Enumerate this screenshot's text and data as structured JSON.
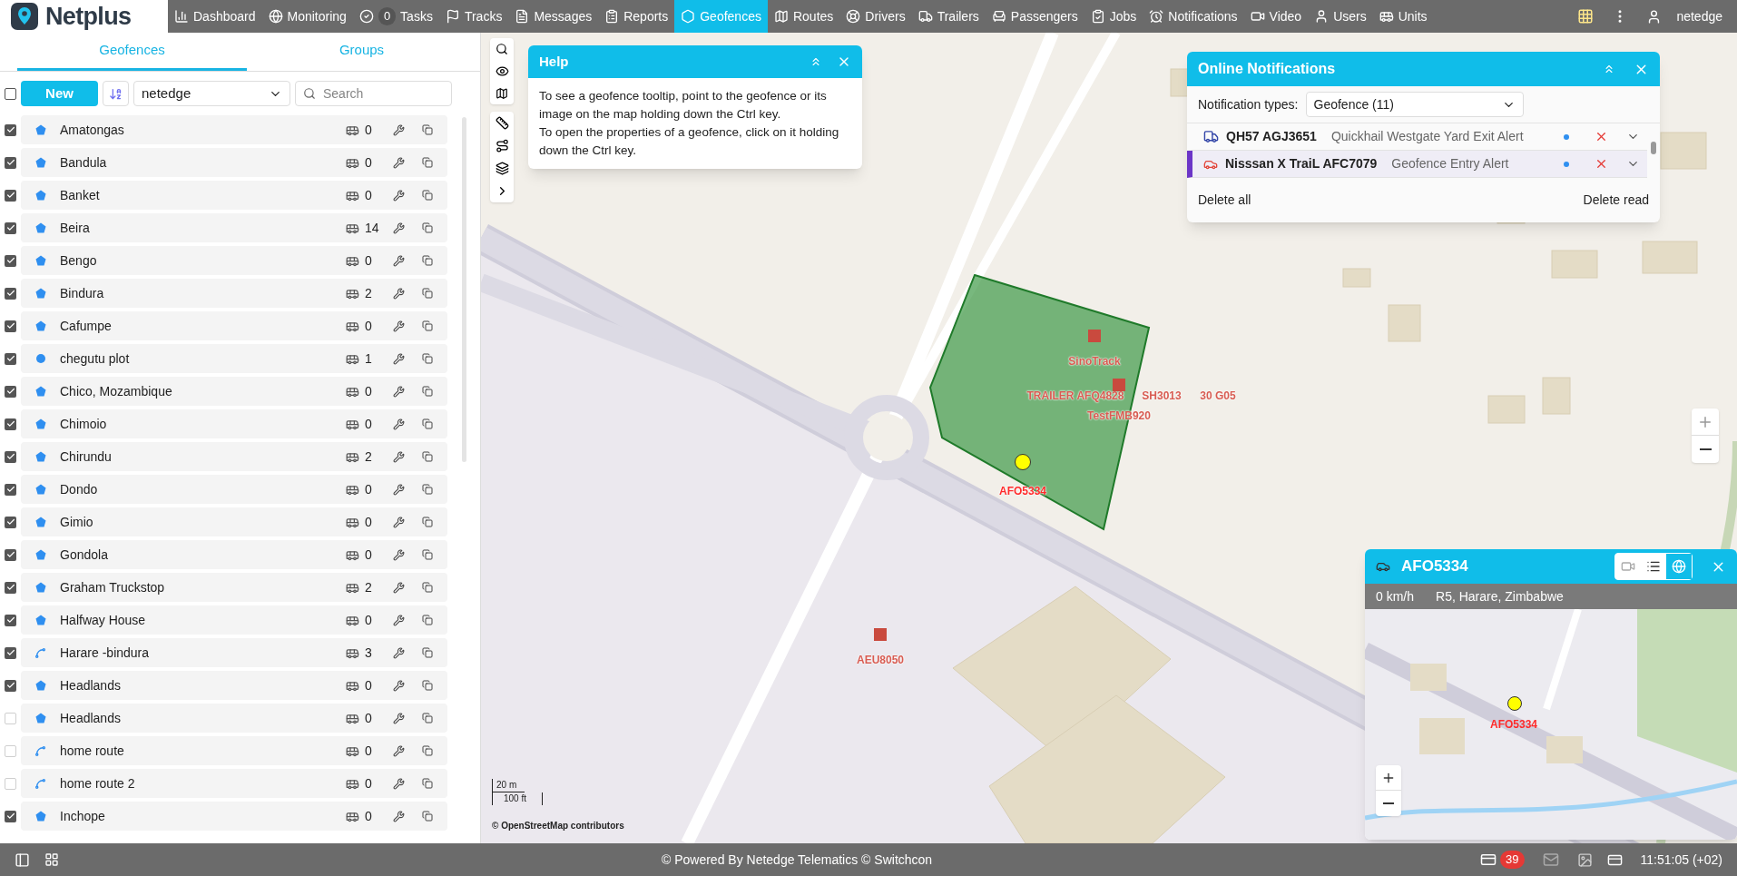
{
  "brand": "Netplus",
  "nav": [
    {
      "label": "Dashboard",
      "selected": false
    },
    {
      "label": "Monitoring",
      "selected": false
    },
    {
      "label": "Tasks",
      "badge": "0",
      "selected": false
    },
    {
      "label": "Tracks",
      "selected": false
    },
    {
      "label": "Messages",
      "selected": false
    },
    {
      "label": "Reports",
      "selected": false
    },
    {
      "label": "Geofences",
      "selected": true
    },
    {
      "label": "Routes",
      "selected": false
    },
    {
      "label": "Drivers",
      "selected": false
    },
    {
      "label": "Trailers",
      "selected": false
    },
    {
      "label": "Passengers",
      "selected": false
    },
    {
      "label": "Jobs",
      "selected": false
    },
    {
      "label": "Notifications",
      "selected": false
    },
    {
      "label": "Video",
      "selected": false
    },
    {
      "label": "Users",
      "selected": false
    },
    {
      "label": "Units",
      "selected": false
    }
  ],
  "user": "netedge",
  "panel_tabs": [
    {
      "label": "Geofences",
      "selected": true
    },
    {
      "label": "Groups",
      "selected": false
    }
  ],
  "toolbar": {
    "select_all": false,
    "new_button": "New",
    "account": "netedge",
    "search": {
      "placeholder": "Search"
    }
  },
  "geofences": [
    {
      "name": "Amatongas",
      "kind": "polygon",
      "checked": true,
      "units": "0"
    },
    {
      "name": "Bandula",
      "kind": "polygon",
      "checked": true,
      "units": "0"
    },
    {
      "name": "Banket",
      "kind": "polygon",
      "checked": true,
      "units": "0"
    },
    {
      "name": "Beira",
      "kind": "polygon",
      "checked": true,
      "units": "14"
    },
    {
      "name": "Bengo",
      "kind": "polygon",
      "checked": true,
      "units": "0"
    },
    {
      "name": "Bindura",
      "kind": "polygon",
      "checked": true,
      "units": "2"
    },
    {
      "name": "Cafumpe",
      "kind": "polygon",
      "checked": true,
      "units": "0"
    },
    {
      "name": "chegutu plot",
      "kind": "circle",
      "checked": true,
      "units": "1"
    },
    {
      "name": "Chico, Mozambique",
      "kind": "polygon",
      "checked": true,
      "units": "0"
    },
    {
      "name": "Chimoio",
      "kind": "polygon",
      "checked": true,
      "units": "0"
    },
    {
      "name": "Chirundu",
      "kind": "polygon",
      "checked": true,
      "units": "2"
    },
    {
      "name": "Dondo",
      "kind": "polygon",
      "checked": true,
      "units": "0"
    },
    {
      "name": "Gimio",
      "kind": "polygon",
      "checked": true,
      "units": "0"
    },
    {
      "name": "Gondola",
      "kind": "polygon",
      "checked": true,
      "units": "0"
    },
    {
      "name": "Graham Truckstop",
      "kind": "polygon",
      "checked": true,
      "units": "2"
    },
    {
      "name": "Halfway House",
      "kind": "polygon",
      "checked": true,
      "units": "0"
    },
    {
      "name": "Harare -bindura",
      "kind": "line",
      "checked": true,
      "units": "3"
    },
    {
      "name": "Headlands",
      "kind": "polygon",
      "checked": true,
      "units": "0"
    },
    {
      "name": "Headlands",
      "kind": "polygon",
      "checked": false,
      "units": "0"
    },
    {
      "name": "home route",
      "kind": "line",
      "checked": false,
      "units": "0"
    },
    {
      "name": "home route 2",
      "kind": "line",
      "checked": false,
      "units": "0"
    },
    {
      "name": "Inchope",
      "kind": "polygon",
      "checked": true,
      "units": "0"
    }
  ],
  "help": {
    "title": "Help",
    "lines": [
      "To see a geofence tooltip, point to the geofence or its image on the map holding down the Ctrl key.",
      "To open the properties of a geofence, click on it holding down the Ctrl key."
    ]
  },
  "map_labels": [
    {
      "text": "SinoTrack",
      "kind": "square"
    },
    {
      "text": "TRAILER AFQ4828",
      "kind": "square"
    },
    {
      "text": "SH3013",
      "kind": "square"
    },
    {
      "text": "30 G05",
      "kind": "square"
    },
    {
      "text": "TestFMB920",
      "kind": "square"
    },
    {
      "text": "AFO5334",
      "kind": "dot"
    },
    {
      "text": "AEU8050",
      "kind": "square"
    }
  ],
  "scale": {
    "metric": "20 m",
    "imperial": "100 ft"
  },
  "attribution": "© OpenStreetMap contributors",
  "notifications": {
    "title": "Online Notifications",
    "types_label": "Notification types:",
    "types_value": "Geofence (11)",
    "items": [
      {
        "unit": "QH57 AGJ3651",
        "text": "Quickhail Westgate Yard Exit Alert",
        "kind": "truck",
        "selected": false
      },
      {
        "unit": "Nisssan X TraiL AFC7079",
        "text": "Geofence Entry Alert",
        "kind": "car",
        "selected": true
      }
    ],
    "delete_all": "Delete all",
    "delete_read": "Delete read"
  },
  "unit_popup": {
    "name": "AFO5334",
    "speed": "0 km/h",
    "address": "R5, Harare, Zimbabwe",
    "marker": "AFO5334"
  },
  "status_bar": {
    "footer": "© Powered By Netedge Telematics © Switchcon",
    "messages": "39",
    "time": "11:51:05 (+02)"
  }
}
